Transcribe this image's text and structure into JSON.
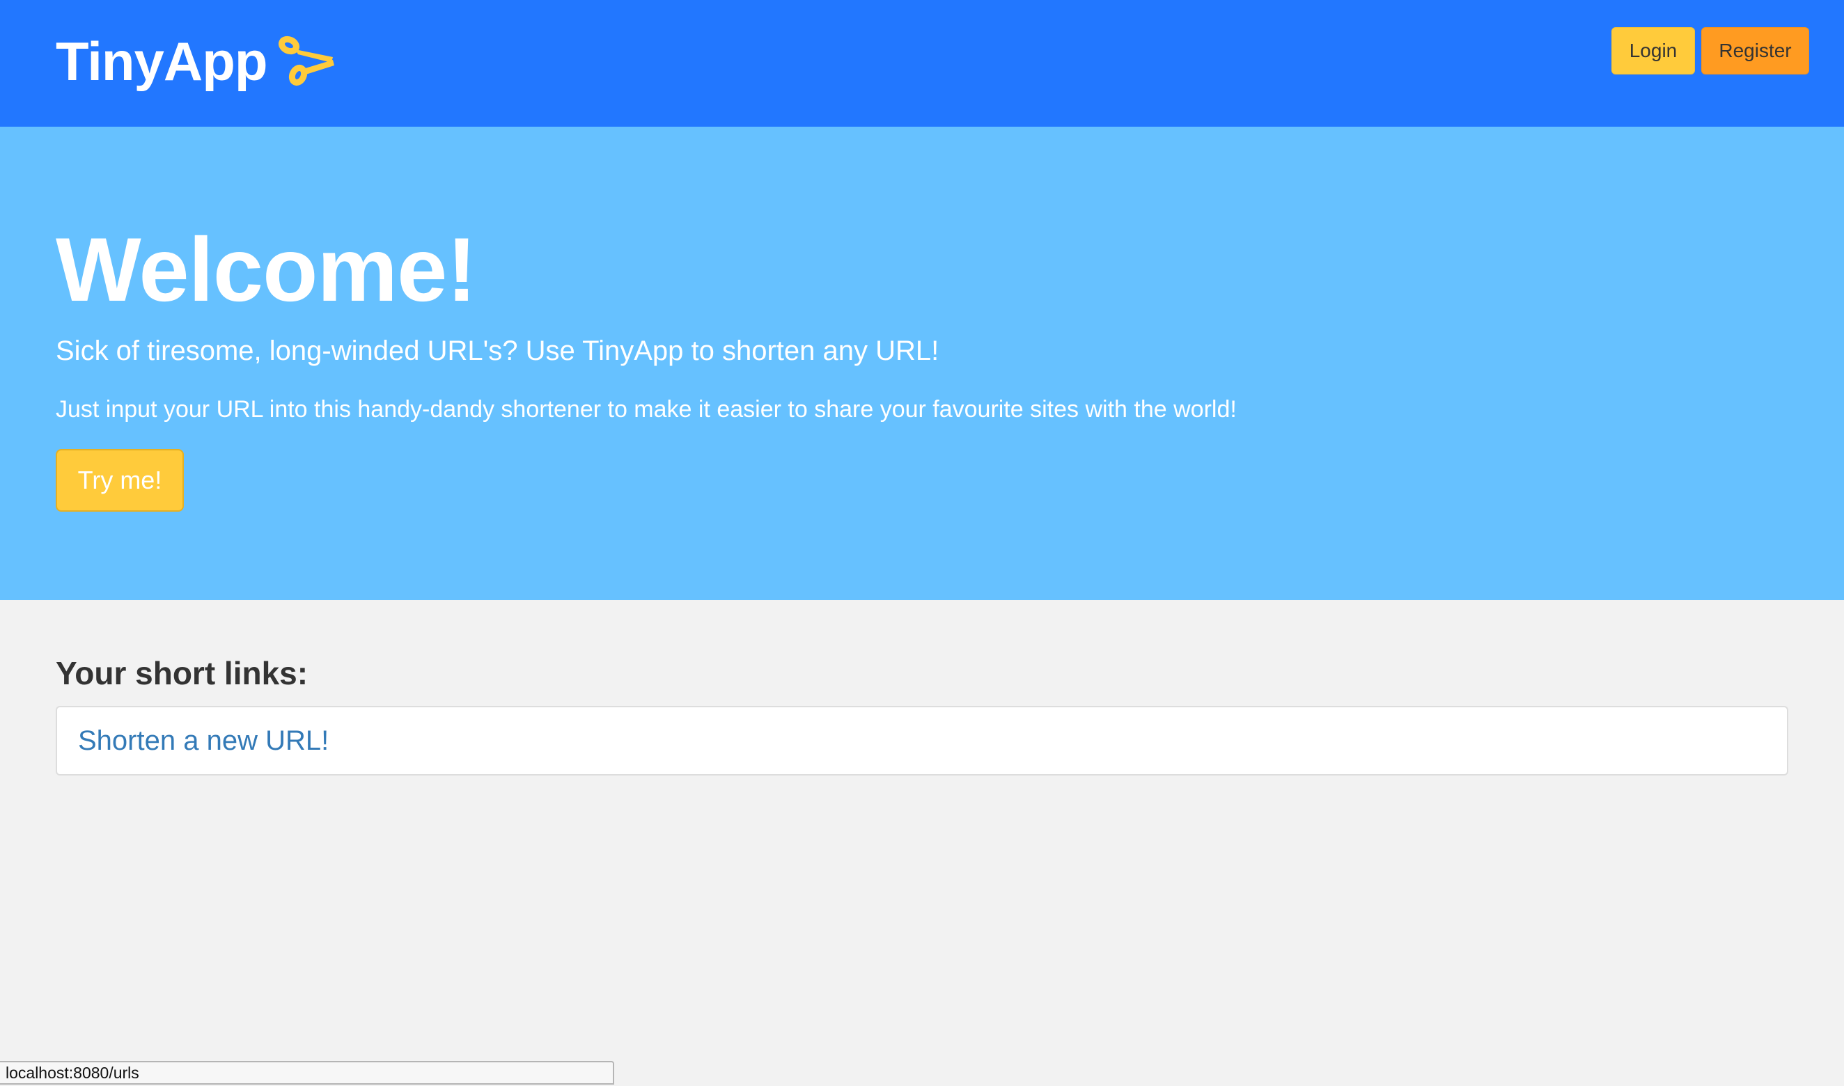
{
  "navbar": {
    "brand": "TinyApp",
    "logo_icon": "scissors-icon",
    "login_label": "Login",
    "register_label": "Register"
  },
  "hero": {
    "title": "Welcome!",
    "subtitle": "Sick of tiresome, long-winded URL's? Use TinyApp to shorten any URL!",
    "text": "Just input your URL into this handy-dandy shortener to make it easier to share your favourite sites with the world!",
    "cta_label": "Try me!"
  },
  "main": {
    "section_title": "Your short links:",
    "new_url_link": "Shorten a new URL!"
  },
  "status_bar": {
    "url": "localhost:8080/urls"
  },
  "colors": {
    "navbar": "#2277ff",
    "hero": "#66c1ff",
    "login": "#ffcb3b",
    "register": "#ff9b21",
    "link": "#337ab7",
    "logo": "#ffcb3b"
  }
}
